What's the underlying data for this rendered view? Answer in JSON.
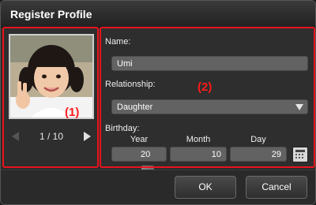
{
  "window": {
    "title": "Register Profile"
  },
  "photo": {
    "counter": "1 / 10",
    "callout": "(1)"
  },
  "form": {
    "callout": "(2)",
    "name_label": "Name:",
    "name_value": "Umi",
    "relationship_label": "Relationship:",
    "relationship_value": "Daughter",
    "birthday_label": "Birthday:",
    "year_label": "Year",
    "month_label": "Month",
    "day_label": "Day",
    "year_value": "20",
    "month_value": "10",
    "day_value": "29"
  },
  "buttons": {
    "ok": "OK",
    "cancel": "Cancel"
  },
  "colors": {
    "accent_red": "#e8141c",
    "field_bg": "#626262",
    "panel_bg": "#2e2e2e"
  },
  "icons": [
    "prev-arrow-icon",
    "next-arrow-icon",
    "dropdown-arrow-icon",
    "calendar-icon"
  ]
}
